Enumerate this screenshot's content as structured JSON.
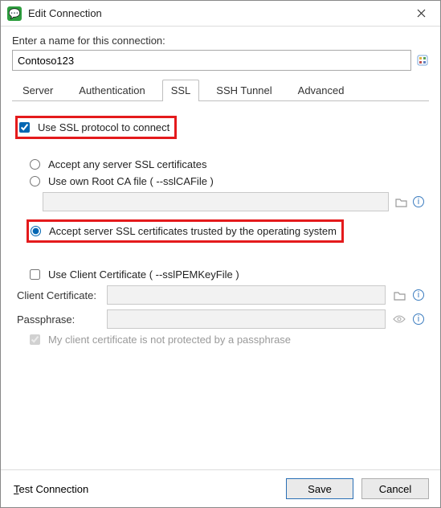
{
  "window": {
    "title": "Edit Connection"
  },
  "form": {
    "name_label": "Enter a name for this connection:",
    "name_value": "Contoso123"
  },
  "tabs": {
    "server": "Server",
    "authentication": "Authentication",
    "ssl": "SSL",
    "ssh": "SSH Tunnel",
    "advanced": "Advanced",
    "active": "ssl"
  },
  "ssl": {
    "use_ssl_label": "Use SSL protocol to connect",
    "use_ssl_checked": true,
    "radio_accept_any": "Accept any server SSL certificates",
    "radio_own_ca": "Use own Root CA file ( --sslCAFile )",
    "radio_accept_os": "Accept server SSL certificates trusted by the operating system",
    "radio_selected": "accept_os",
    "ca_file_value": "",
    "use_client_cert_label": "Use Client Certificate ( --sslPEMKeyFile )",
    "use_client_cert_checked": false,
    "client_cert_label": "Client Certificate:",
    "client_cert_value": "",
    "passphrase_label": "Passphrase:",
    "passphrase_value": "",
    "no_passphrase_label": "My client certificate is not protected by a passphrase",
    "no_passphrase_checked": true
  },
  "footer": {
    "test_prefix": "T",
    "test_rest": "est Connection",
    "save": "Save",
    "cancel": "Cancel"
  }
}
